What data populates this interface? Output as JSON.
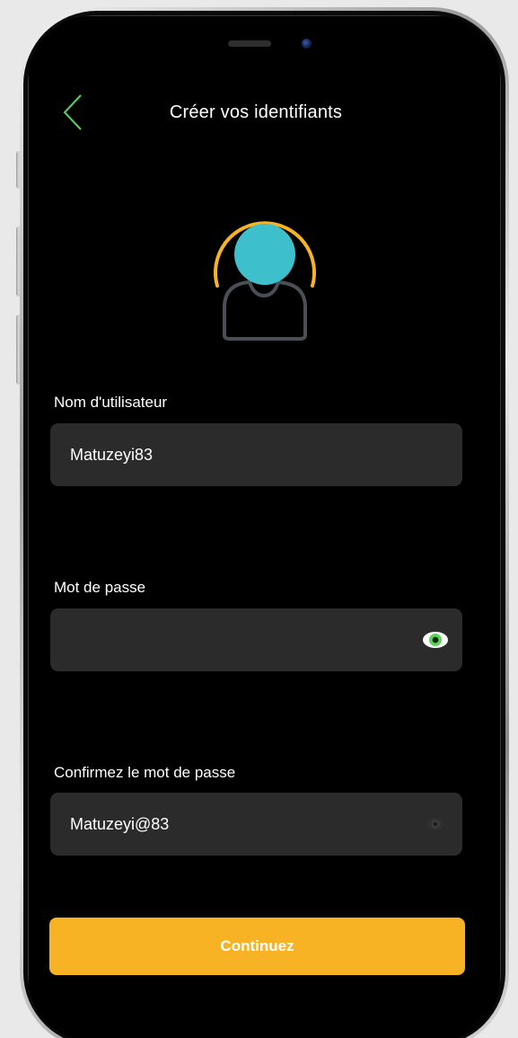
{
  "header": {
    "back_icon": "chevron-left-icon",
    "title": "Créer vos identifiants"
  },
  "avatar": {
    "icon": "user-avatar-icon",
    "head_color": "#3ebfcc",
    "ring_color": "#f8b325",
    "body_color": "#4a4f55"
  },
  "form": {
    "username": {
      "label": "Nom d'utilisateur",
      "value": "Matuzeyi83"
    },
    "password": {
      "label": "Mot de passe",
      "value": "",
      "toggle_icon": "eye-icon",
      "toggle_color": "#5bd25b"
    },
    "confirm_password": {
      "label": "Confirmez le mot de passe",
      "value": "Matuzeyi@83",
      "toggle_icon": "eye-icon",
      "toggle_color": "#3a3a3a"
    }
  },
  "actions": {
    "continue_label": "Continuez",
    "continue_color": "#f8b325"
  },
  "theme": {
    "accent_green": "#5bd25b",
    "background": "#000000",
    "field_background": "#2b2b2b"
  }
}
